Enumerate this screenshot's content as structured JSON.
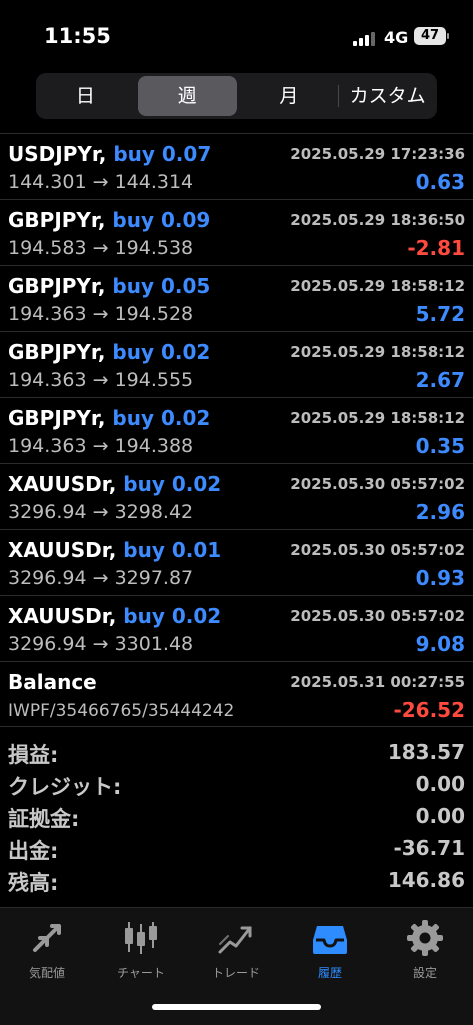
{
  "status": {
    "time": "11:55",
    "network": "4G",
    "battery": "47"
  },
  "segments": [
    {
      "label": "日",
      "active": false
    },
    {
      "label": "週",
      "active": true
    },
    {
      "label": "月",
      "active": false
    },
    {
      "label": "カスタム",
      "active": false
    }
  ],
  "trades": [
    {
      "symbol": "USDJPYr,",
      "direction": "buy 0.07",
      "datetime": "2025.05.29 17:23:36",
      "prices": "144.301 → 144.314",
      "profit": "0.63"
    },
    {
      "symbol": "GBPJPYr,",
      "direction": "buy 0.09",
      "datetime": "2025.05.29 18:36:50",
      "prices": "194.583 → 194.538",
      "profit": "-2.81"
    },
    {
      "symbol": "GBPJPYr,",
      "direction": "buy 0.05",
      "datetime": "2025.05.29 18:58:12",
      "prices": "194.363 → 194.528",
      "profit": "5.72"
    },
    {
      "symbol": "GBPJPYr,",
      "direction": "buy 0.02",
      "datetime": "2025.05.29 18:58:12",
      "prices": "194.363 → 194.555",
      "profit": "2.67"
    },
    {
      "symbol": "GBPJPYr,",
      "direction": "buy 0.02",
      "datetime": "2025.05.29 18:58:12",
      "prices": "194.363 → 194.388",
      "profit": "0.35"
    },
    {
      "symbol": "XAUUSDr,",
      "direction": "buy 0.02",
      "datetime": "2025.05.30 05:57:02",
      "prices": "3296.94 → 3298.42",
      "profit": "2.96"
    },
    {
      "symbol": "XAUUSDr,",
      "direction": "buy 0.01",
      "datetime": "2025.05.30 05:57:02",
      "prices": "3296.94 → 3297.87",
      "profit": "0.93"
    },
    {
      "symbol": "XAUUSDr,",
      "direction": "buy 0.02",
      "datetime": "2025.05.30 05:57:02",
      "prices": "3296.94 → 3301.48",
      "profit": "9.08"
    }
  ],
  "balance": {
    "label": "Balance",
    "datetime": "2025.05.31 00:27:55",
    "comment": "IWPF/35466765/35444242",
    "amount": "-26.52"
  },
  "summary": [
    {
      "label": "損益:",
      "value": "183.57"
    },
    {
      "label": "クレジット:",
      "value": "0.00"
    },
    {
      "label": "証拠金:",
      "value": "0.00"
    },
    {
      "label": "出金:",
      "value": "-36.71"
    },
    {
      "label": "残高:",
      "value": "146.86"
    }
  ],
  "tabs": [
    {
      "label": "気配値",
      "icon": "quotes-icon",
      "active": false
    },
    {
      "label": "チャート",
      "icon": "chart-icon",
      "active": false
    },
    {
      "label": "トレード",
      "icon": "trade-icon",
      "active": false
    },
    {
      "label": "履歴",
      "icon": "history-icon",
      "active": true
    },
    {
      "label": "設定",
      "icon": "settings-icon",
      "active": false
    }
  ],
  "colors": {
    "accent": "#3d8bff",
    "loss": "#ff4a3f",
    "tab_active": "#2f8cff"
  }
}
